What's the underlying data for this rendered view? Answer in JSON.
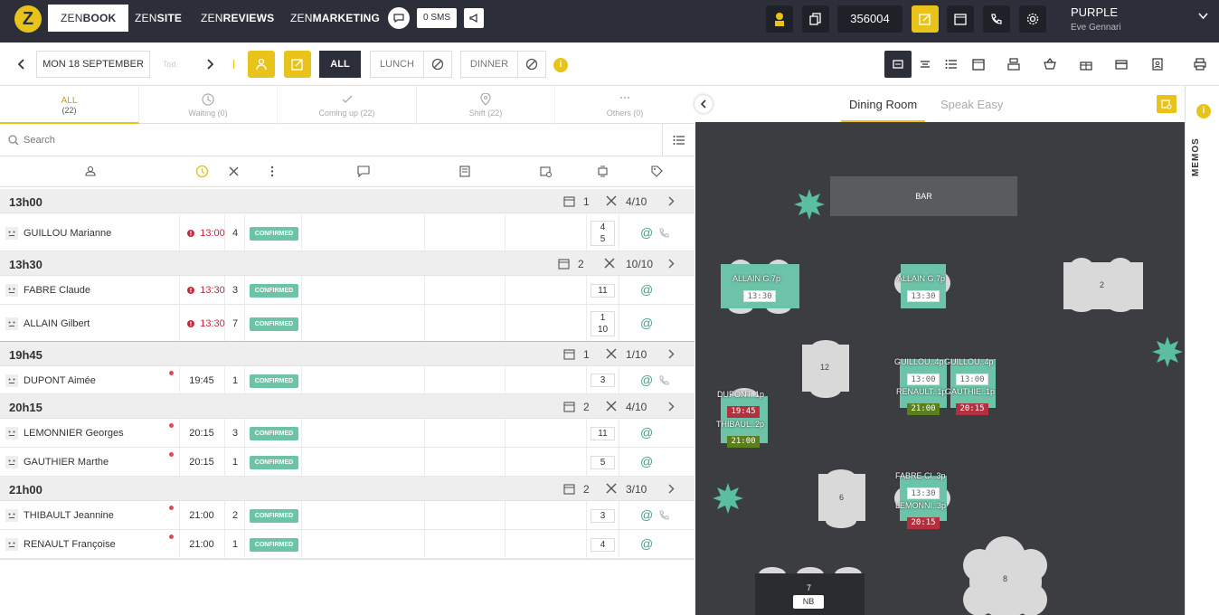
{
  "topbar": {
    "logo": "Z",
    "tabs": [
      {
        "zen": "ZEN",
        "rest": "BOOK"
      },
      {
        "zen": "ZEN",
        "rest": "SITE"
      },
      {
        "zen": "ZEN",
        "rest": "REVIEWS"
      },
      {
        "zen": "ZEN",
        "rest": "MARKETING"
      }
    ],
    "sms_label": "0 SMS",
    "counter": "356004",
    "user_name": "PURPLE",
    "user_sub": "Eve Gennari"
  },
  "toolbar": {
    "date": "MON 18 SEPTEMBER",
    "today": "Tod.",
    "filter_all": "ALL",
    "filter_lunch": "LUNCH",
    "filter_dinner": "DINNER",
    "info": "i"
  },
  "list_tabs": [
    {
      "label": "ALL",
      "count": "(22)"
    },
    {
      "label": "Waiting (0)"
    },
    {
      "label": "Coming up (22)"
    },
    {
      "label": "Shift (22)"
    },
    {
      "label": "Others (0)"
    }
  ],
  "search": {
    "placeholder": "Search"
  },
  "groups": [
    {
      "time": "13h00",
      "bookings": "1",
      "covers": "4/10"
    },
    {
      "time": "13h30",
      "bookings": "2",
      "covers": "10/10"
    },
    {
      "time": "19h45",
      "bookings": "1",
      "covers": "1/10"
    },
    {
      "time": "20h15",
      "bookings": "2",
      "covers": "4/10"
    },
    {
      "time": "21h00",
      "bookings": "2",
      "covers": "3/10"
    }
  ],
  "reservations": [
    {
      "name": "GUILLOU Marianne",
      "time": "13:00",
      "late": true,
      "covers": "4",
      "status": "CONFIRMED",
      "tables": "4\n5"
    },
    {
      "name": "FABRE Claude",
      "time": "13:30",
      "late": true,
      "covers": "3",
      "status": "CONFIRMED",
      "tables": "11"
    },
    {
      "name": "ALLAIN Gilbert",
      "time": "13:30",
      "late": true,
      "covers": "7",
      "status": "CONFIRMED",
      "tables": "1\n10"
    },
    {
      "name": "DUPONT Aimée",
      "time": "19:45",
      "late": false,
      "covers": "1",
      "status": "CONFIRMED",
      "tables": "3"
    },
    {
      "name": "LEMONNIER Georges",
      "time": "20:15",
      "late": false,
      "covers": "3",
      "status": "CONFIRMED",
      "tables": "11"
    },
    {
      "name": "GAUTHIER Marthe",
      "time": "20:15",
      "late": false,
      "covers": "1",
      "status": "CONFIRMED",
      "tables": "5"
    },
    {
      "name": "THIBAULT Jeannine",
      "time": "21:00",
      "late": false,
      "covers": "2",
      "status": "CONFIRMED",
      "tables": "3"
    },
    {
      "name": "RENAULT Françoise",
      "time": "21:00",
      "late": false,
      "covers": "1",
      "status": "CONFIRMED",
      "tables": "4"
    }
  ],
  "floor": {
    "tabs": [
      "Dining Room",
      "Speak Easy"
    ],
    "bar": "BAR",
    "memos": "MEMOS",
    "labels": {
      "t1": "ALLAIN G.7p",
      "t1_time": "13:30",
      "t10": "ALLAIN G.7p",
      "t10_time": "13:30",
      "t2": "2",
      "t12": "12",
      "t4a": "GUILLOU..4p",
      "t4a_time": "13:00",
      "t5a": "GUILLOU..4p",
      "t5a_time": "13:00",
      "t4b": "RENAULT..1p",
      "t4b_time": "21:00",
      "t5b": "GAUTHIE..1p",
      "t5b_time": "20:15",
      "t3a": "DUPONT..1p",
      "t3a_time": "19:45",
      "t3b": "THIBAUL..2p",
      "t3b_time": "21:00",
      "t6": "6",
      "t11a": "FABRE Cl..3p",
      "t11a_time": "13:30",
      "t11b": "LEMONNI..3p",
      "t11b_time": "20:15",
      "t7": "7",
      "t7_nb": "NB",
      "t8": "8"
    }
  },
  "colors": {
    "accent": "#e8c41a",
    "dark": "#2c2f3a",
    "confirmed": "#6cc3a7",
    "late": "#c8283c",
    "floor": "#3b3d40"
  }
}
